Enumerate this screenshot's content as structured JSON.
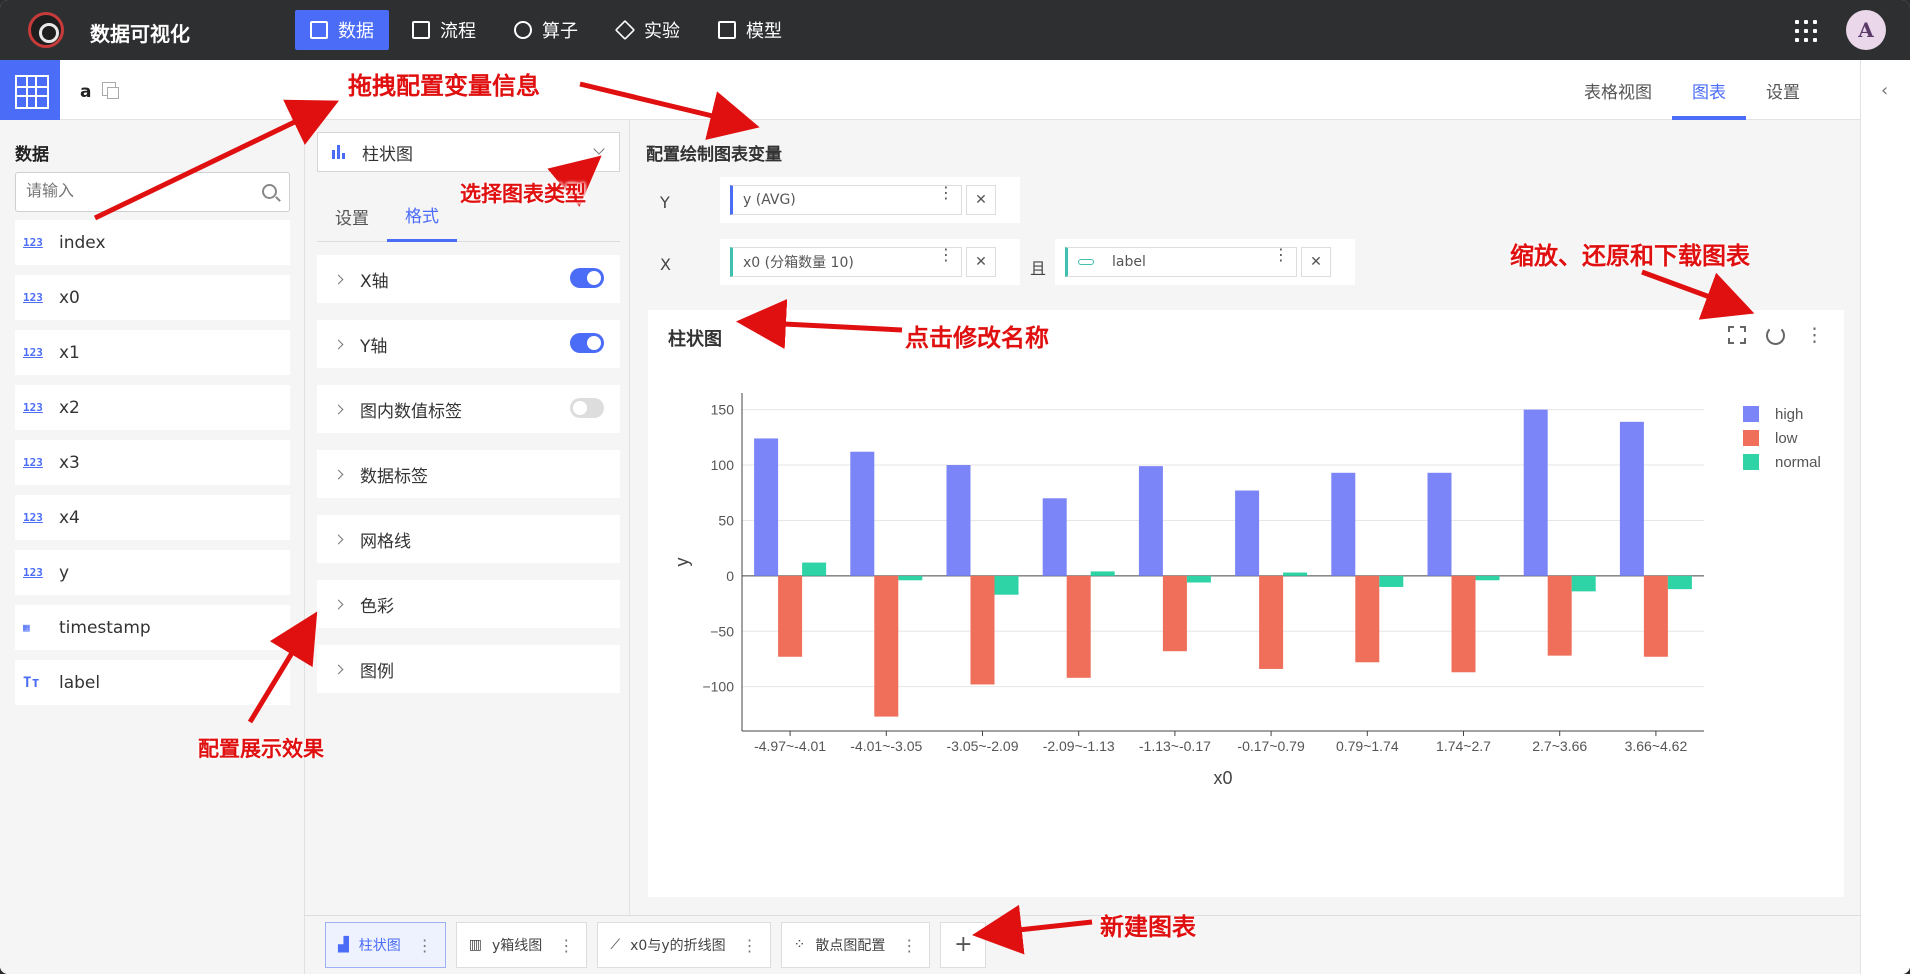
{
  "app": {
    "title": "数据可视化",
    "avatar": "A"
  },
  "nav": [
    {
      "label": "数据",
      "icon": "table-icon",
      "active": true
    },
    {
      "label": "流程",
      "icon": "flow-icon",
      "active": false
    },
    {
      "label": "算子",
      "icon": "operator-icon",
      "active": false
    },
    {
      "label": "实验",
      "icon": "cube-icon",
      "active": false
    },
    {
      "label": "模型",
      "icon": "save-icon",
      "active": false
    }
  ],
  "dataset": {
    "name": "a"
  },
  "view_tabs": [
    {
      "label": "表格视图",
      "active": false
    },
    {
      "label": "图表",
      "active": true
    },
    {
      "label": "设置",
      "active": false
    }
  ],
  "data_panel": {
    "title": "数据",
    "search_placeholder": "请输入",
    "fields": [
      {
        "type": "numeric",
        "icon": "123",
        "name": "index"
      },
      {
        "type": "numeric",
        "icon": "123",
        "name": "x0"
      },
      {
        "type": "numeric",
        "icon": "123",
        "name": "x1"
      },
      {
        "type": "numeric",
        "icon": "123",
        "name": "x2"
      },
      {
        "type": "numeric",
        "icon": "123",
        "name": "x3"
      },
      {
        "type": "numeric",
        "icon": "123",
        "name": "x4"
      },
      {
        "type": "numeric",
        "icon": "123",
        "name": "y"
      },
      {
        "type": "date",
        "icon": "calendar-icon",
        "name": "timestamp"
      },
      {
        "type": "text",
        "icon": "Tт",
        "name": "label"
      }
    ]
  },
  "config_panel": {
    "chart_type": "柱状图",
    "tabs": [
      {
        "label": "设置",
        "active": false
      },
      {
        "label": "格式",
        "active": true
      }
    ],
    "options": [
      {
        "label": "X轴",
        "toggle": true
      },
      {
        "label": "Y轴",
        "toggle": true
      },
      {
        "label": "图内数值标签",
        "toggle": false
      },
      {
        "label": "数据标签",
        "toggle": null
      },
      {
        "label": "网格线",
        "toggle": null
      },
      {
        "label": "色彩",
        "toggle": null
      },
      {
        "label": "图例",
        "toggle": null
      }
    ]
  },
  "variables": {
    "title": "配置绘制图表变量",
    "y_label": "Y",
    "y_value": "y (AVG)",
    "x_label": "X",
    "x_value": "x0 (分箱数量 10)",
    "and_label": "且",
    "group_value": "label"
  },
  "chart_card": {
    "title": "柱状图"
  },
  "chart_data": {
    "type": "bar",
    "xlabel": "x0",
    "ylabel": "y",
    "ylim": [
      -140,
      165
    ],
    "yticks": [
      150,
      100,
      50,
      0,
      -50,
      -100
    ],
    "categories": [
      "-4.97~-4.01",
      "-4.01~-3.05",
      "-3.05~-2.09",
      "-2.09~-1.13",
      "-1.13~-0.17",
      "-0.17~0.79",
      "0.79~1.74",
      "1.74~2.7",
      "2.7~3.66",
      "3.66~4.62"
    ],
    "series": [
      {
        "name": "high",
        "color": "#7b85f7",
        "values": [
          124,
          112,
          100,
          70,
          99,
          77,
          93,
          93,
          150,
          139
        ]
      },
      {
        "name": "low",
        "color": "#ef6f5a",
        "values": [
          -73,
          -127,
          -98,
          -92,
          -68,
          -84,
          -78,
          -87,
          -72,
          -73
        ]
      },
      {
        "name": "normal",
        "color": "#2ed3a6",
        "values": [
          12,
          -4,
          -17,
          4,
          -6,
          3,
          -10,
          -4,
          -14,
          -12
        ]
      }
    ],
    "legend_position": "top-right",
    "grid": true
  },
  "chart_tabs": [
    {
      "label": "柱状图",
      "icon": "bar-chart-icon",
      "active": true
    },
    {
      "label": "y箱线图",
      "icon": "box-plot-icon",
      "active": false
    },
    {
      "label": "x0与y的折线图",
      "icon": "line-chart-icon",
      "active": false
    },
    {
      "label": "散点图配置",
      "icon": "scatter-icon",
      "active": false
    }
  ],
  "annotations": {
    "drag": "拖拽配置变量信息",
    "select_type": "选择图表类型",
    "configure_effect": "配置展示效果",
    "rename": "点击修改名称",
    "zoom": "缩放、还原和下载图表",
    "new_chart": "新建图表"
  }
}
